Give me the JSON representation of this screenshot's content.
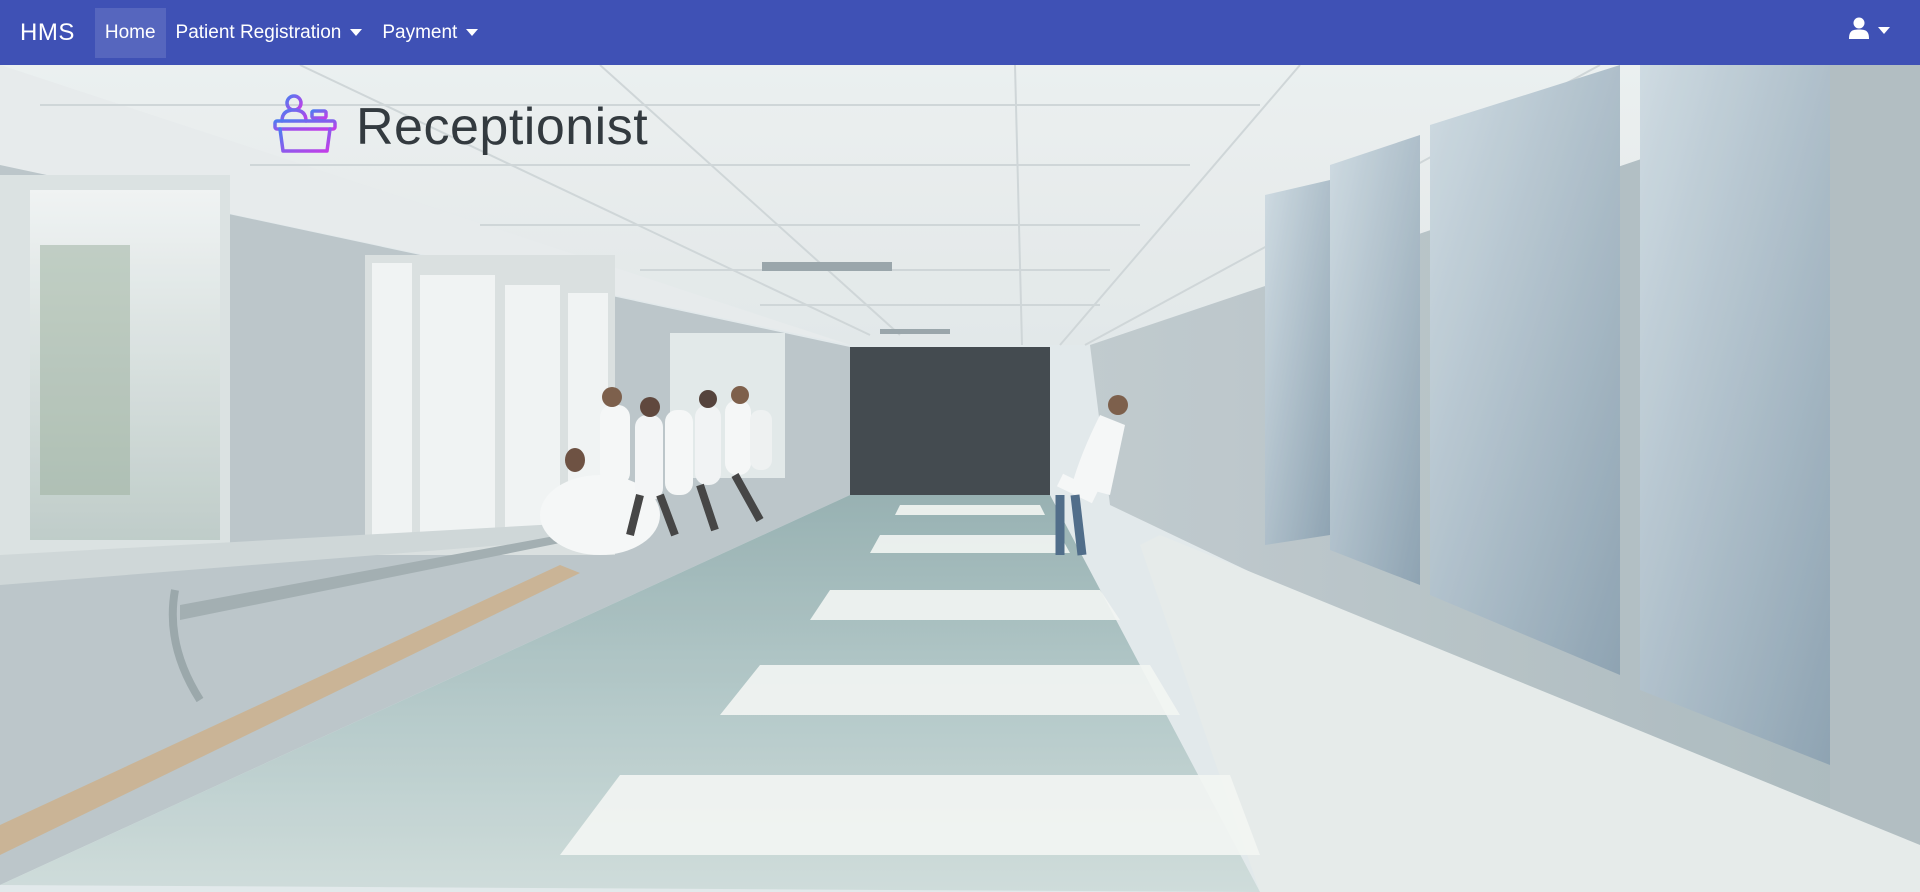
{
  "navbar": {
    "brand": "HMS",
    "items": [
      {
        "label": "Home",
        "active": true,
        "dropdown": false
      },
      {
        "label": "Patient Registration",
        "active": false,
        "dropdown": true
      },
      {
        "label": "Payment",
        "active": false,
        "dropdown": true
      }
    ],
    "user_icon": "user-icon",
    "background_color": "#3f51b5"
  },
  "page": {
    "title": "Receptionist",
    "title_icon": "reception-desk-icon",
    "hero_image": "hospital-corridor-with-doctors"
  }
}
